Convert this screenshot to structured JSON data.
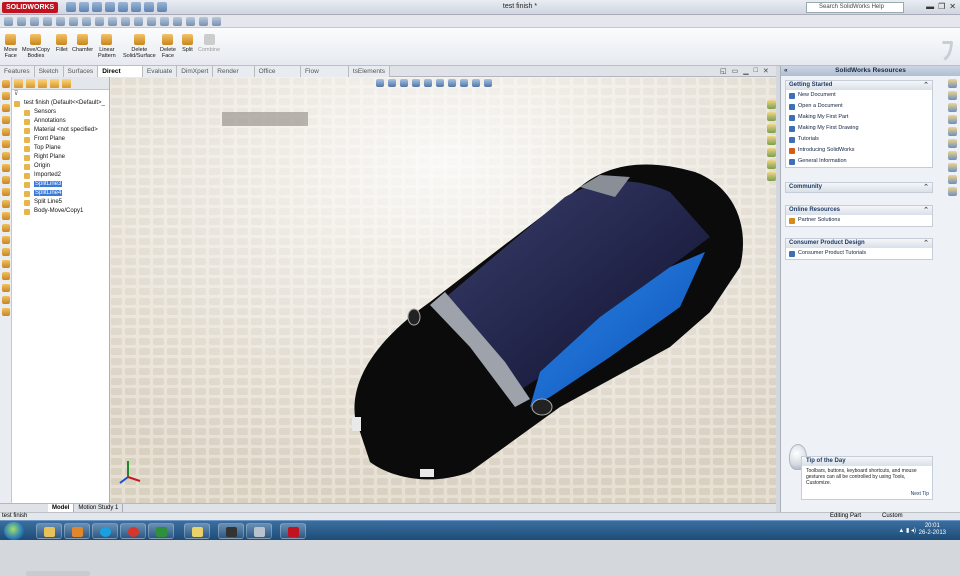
{
  "app": {
    "name": "SOLIDWORKS",
    "document_title": "test finish *"
  },
  "help_search": {
    "placeholder": "Search SolidWorks Help"
  },
  "commands": [
    {
      "label": "Move\nFace",
      "enabled": true
    },
    {
      "label": "Move/Copy\nBodies",
      "enabled": true
    },
    {
      "label": "Fillet",
      "enabled": true
    },
    {
      "label": "Chamfer",
      "enabled": true
    },
    {
      "label": "Linear\nPattern",
      "enabled": true
    },
    {
      "label": "Delete\nSolid/Surface",
      "enabled": true
    },
    {
      "label": "Delete\nFace",
      "enabled": true
    },
    {
      "label": "Split",
      "enabled": true
    },
    {
      "label": "Combine",
      "enabled": false
    }
  ],
  "tabs": [
    "Features",
    "Sketch",
    "Surfaces",
    "Direct Editing",
    "Evaluate",
    "DimXpert",
    "Render Tools",
    "Office Products",
    "Flow Simulation",
    "tsElements"
  ],
  "active_tab": "Direct Editing",
  "tree": {
    "root": "test finish  (Default<<Default>_",
    "nodes": [
      {
        "label": "Sensors",
        "selected": false
      },
      {
        "label": "Annotations",
        "selected": false
      },
      {
        "label": "Material <not specified>",
        "selected": false
      },
      {
        "label": "Front Plane",
        "selected": false
      },
      {
        "label": "Top Plane",
        "selected": false
      },
      {
        "label": "Right Plane",
        "selected": false
      },
      {
        "label": "Origin",
        "selected": false
      },
      {
        "label": "Imported2",
        "selected": false
      },
      {
        "label": "SplitLine3",
        "selected": true
      },
      {
        "label": "SplitLine4",
        "selected": true
      },
      {
        "label": "Split Line5",
        "selected": false
      },
      {
        "label": "Body-Move/Copy1",
        "selected": false
      }
    ]
  },
  "bottom_tabs": [
    "Model",
    "Motion Study 1"
  ],
  "active_bottom_tab": "Model",
  "task_pane": {
    "title": "SolidWorks Resources",
    "sections": [
      {
        "title": "Getting Started",
        "items": [
          "New Document",
          "Open a Document",
          "Making My First Part",
          "Making My First Drawing",
          "Tutorials",
          "Introducing SolidWorks",
          "General Information"
        ]
      },
      {
        "title": "Community",
        "items": []
      },
      {
        "title": "Online Resources",
        "items": [
          "Partner Solutions"
        ]
      },
      {
        "title": "Consumer Product Design",
        "items": [
          "Consumer Product Tutorials"
        ]
      }
    ],
    "tip": {
      "title": "Tip of the Day",
      "text": "Toolbars, buttons, keyboard shortcuts, and mouse gestures can all be controlled by using Tools, Customize.",
      "next": "Next Tip"
    }
  },
  "status": {
    "left": "test finish",
    "mode": "Editing Part",
    "units": "Custom"
  },
  "taskbar": {
    "time": "20:01",
    "date": "26-2-2013"
  },
  "colors": {
    "accent": "#1f6fd6",
    "car_body": "#0b0b0c",
    "ground": "#e4ddd0"
  }
}
